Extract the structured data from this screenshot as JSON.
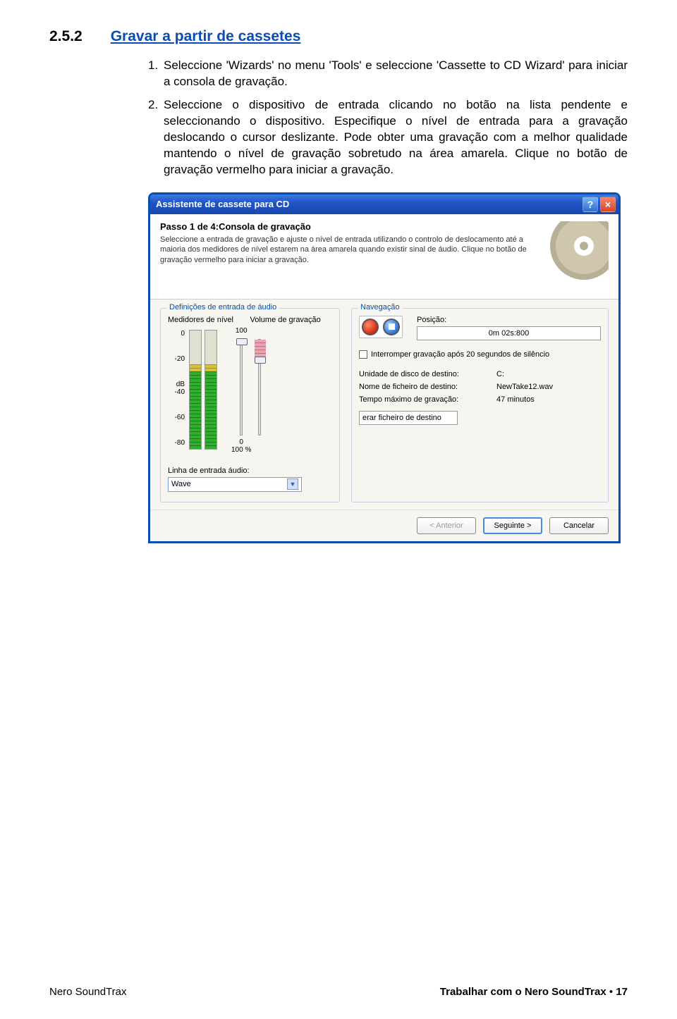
{
  "section": {
    "number": "2.5.2",
    "title": "Gravar a partir de cassetes"
  },
  "paragraphs": {
    "p1_num": "1.",
    "p1": "Seleccione 'Wizards' no menu 'Tools' e seleccione 'Cassette to CD Wizard' para iniciar a consola de gravação.",
    "p2_num": "2.",
    "p2": "Seleccione o dispositivo de entrada clicando no botão na lista pendente e seleccionando o dispositivo. Especifique o nível de entrada para a gravação deslocando o cursor deslizante. Pode obter uma gravação com a melhor qualidade mantendo o nível de gravação sobretudo na área amarela. Clique no botão de gravação vermelho para iniciar a gravação."
  },
  "dialog": {
    "title": "Assistente de cassete para CD",
    "banner": {
      "title": "Passo 1 de 4:Consola de gravação",
      "desc": "Seleccione a entrada de gravação e ajuste o nível de entrada utilizando o controlo de deslocamento até a maioria dos medidores de nível estarem na área amarela quando existir sinal de áudio. Clique no botão de gravação vermelho para iniciar a gravação."
    },
    "left": {
      "legend": "Definições de entrada de áudio",
      "col1": "Medidores de nível",
      "col2": "Volume de gravação",
      "scale": [
        "0",
        "-20",
        "-40",
        "-60",
        "-80"
      ],
      "slider_top": "100",
      "slider_bot": "0",
      "slider_pct": "100 %",
      "line_label": "Linha de entrada áudio:",
      "line_value": "Wave",
      "db_marker": "dB"
    },
    "right": {
      "legend": "Navegação",
      "pos_label": "Posição:",
      "pos_value": "0m 02s:800",
      "chk": "Interromper gravação após 20 segundos de silêncio",
      "kv": [
        {
          "k": "Unidade de disco de destino:",
          "v": "C:"
        },
        {
          "k": "Nome de ficheiro de destino:",
          "v": "NewTake12.wav"
        },
        {
          "k": "Tempo máximo de gravação:",
          "v": "47 minutos"
        }
      ],
      "genfile": "erar ficheiro de destino"
    },
    "buttons": {
      "back": "< Anterior",
      "next": "Seguinte >",
      "cancel": "Cancelar"
    }
  },
  "footer": {
    "left": "Nero SoundTrax",
    "right_label": "Trabalhar com o Nero SoundTrax",
    "bullet": "•",
    "page": "17"
  }
}
